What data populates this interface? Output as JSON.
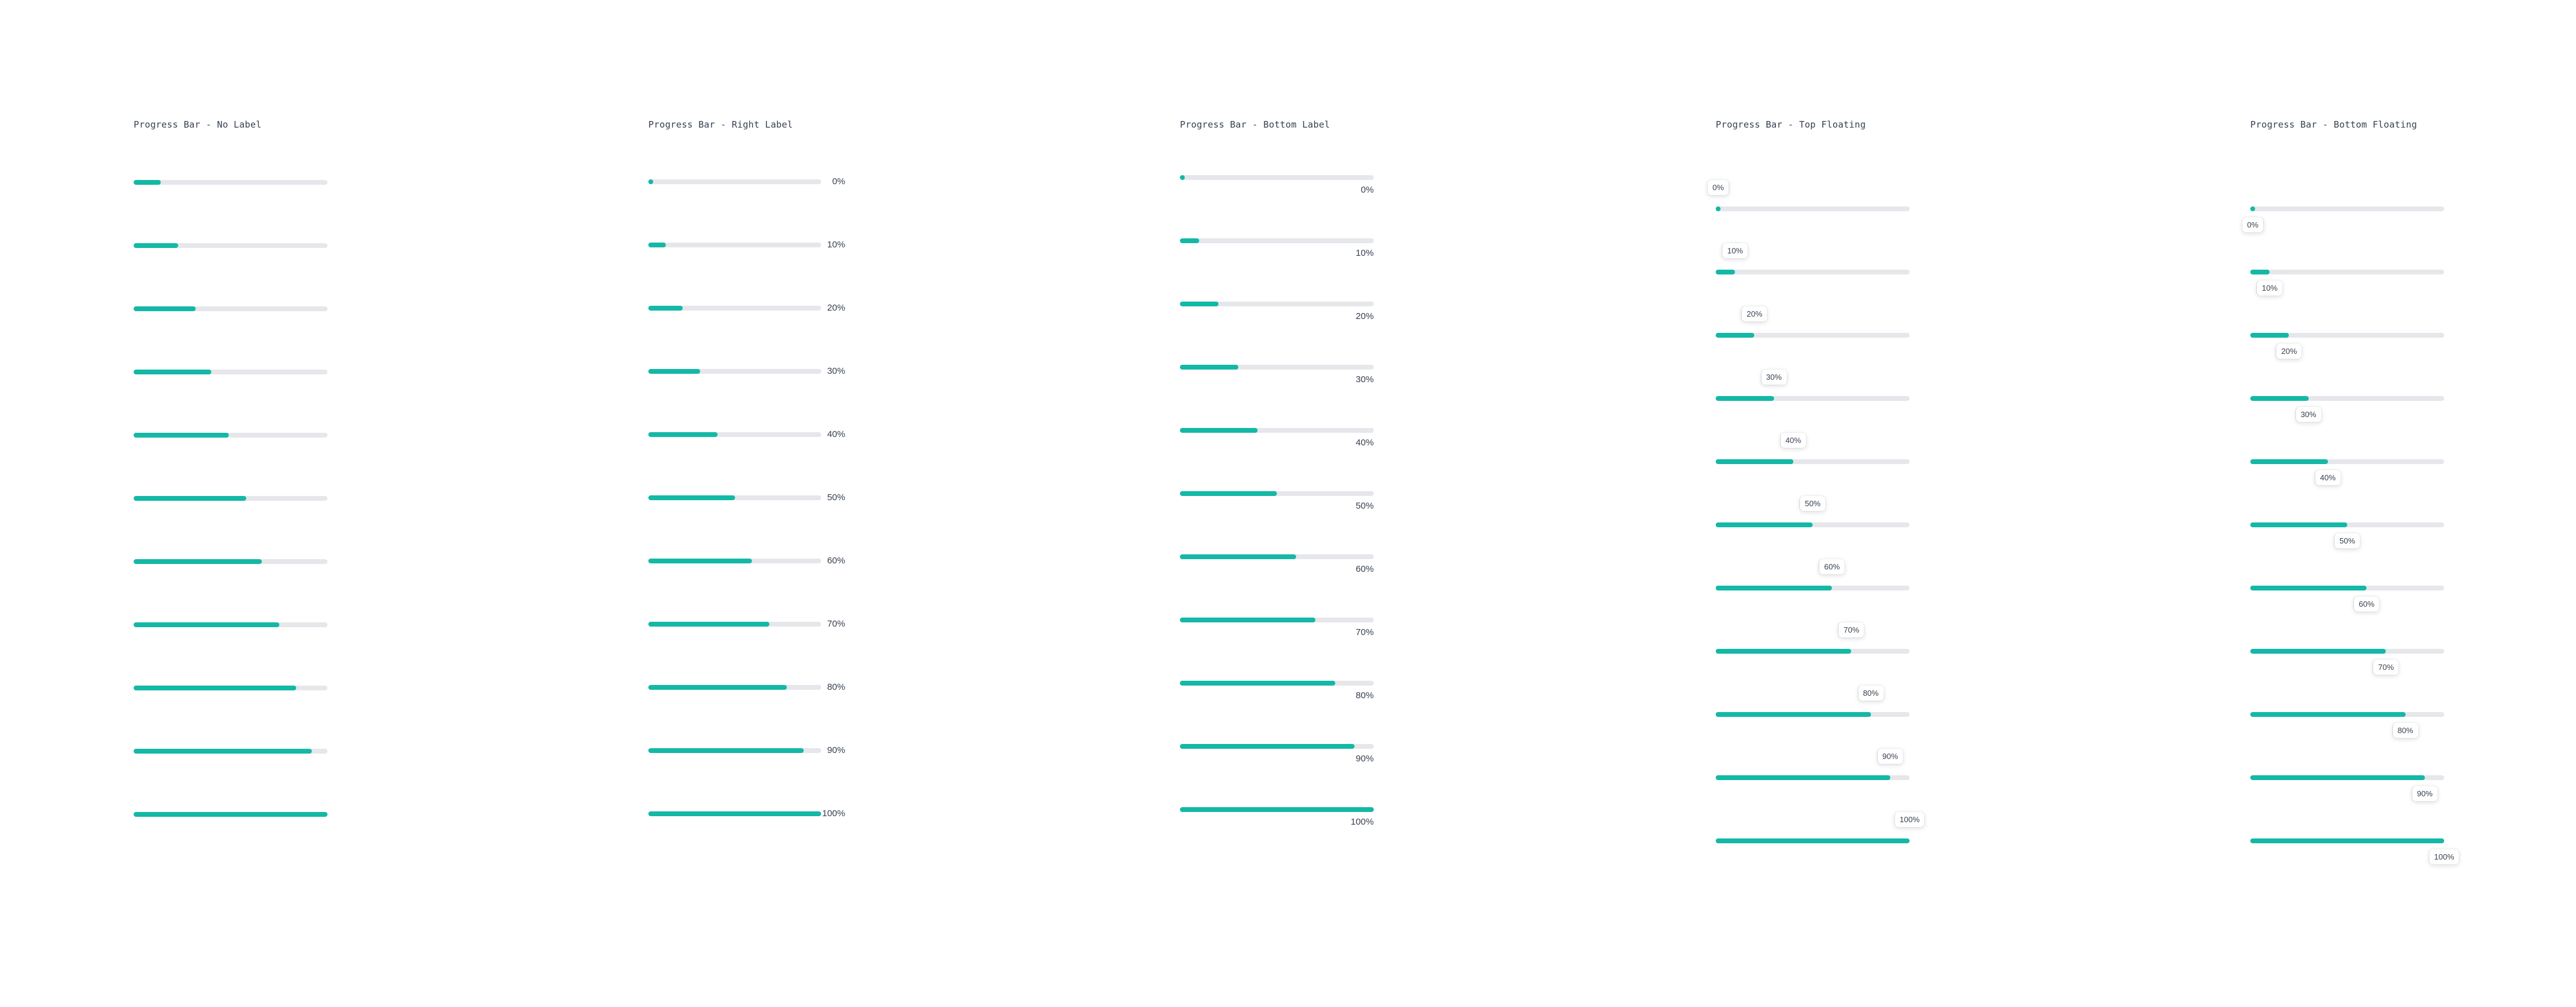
{
  "colors": {
    "fill": "#14b8a6",
    "track": "#e5e7eb",
    "text": "#374151"
  },
  "columns": [
    {
      "title": "Progress Bar - No Label",
      "label_style": "none",
      "items": [
        {
          "value": 0.14,
          "label": ""
        },
        {
          "value": 0.23,
          "label": ""
        },
        {
          "value": 0.32,
          "label": ""
        },
        {
          "value": 0.4,
          "label": ""
        },
        {
          "value": 0.49,
          "label": ""
        },
        {
          "value": 0.58,
          "label": ""
        },
        {
          "value": 0.66,
          "label": ""
        },
        {
          "value": 0.75,
          "label": ""
        },
        {
          "value": 0.84,
          "label": ""
        },
        {
          "value": 0.92,
          "label": ""
        },
        {
          "value": 1.0,
          "label": ""
        }
      ]
    },
    {
      "title": "Progress Bar - Right Label",
      "label_style": "right",
      "items": [
        {
          "value": 0.0,
          "label": "0%"
        },
        {
          "value": 0.1,
          "label": "10%"
        },
        {
          "value": 0.2,
          "label": "20%"
        },
        {
          "value": 0.3,
          "label": "30%"
        },
        {
          "value": 0.4,
          "label": "40%"
        },
        {
          "value": 0.5,
          "label": "50%"
        },
        {
          "value": 0.6,
          "label": "60%"
        },
        {
          "value": 0.7,
          "label": "70%"
        },
        {
          "value": 0.8,
          "label": "80%"
        },
        {
          "value": 0.9,
          "label": "90%"
        },
        {
          "value": 1.0,
          "label": "100%"
        }
      ]
    },
    {
      "title": "Progress Bar - Bottom Label",
      "label_style": "bottom",
      "items": [
        {
          "value": 0.0,
          "label": "0%"
        },
        {
          "value": 0.1,
          "label": "10%"
        },
        {
          "value": 0.2,
          "label": "20%"
        },
        {
          "value": 0.3,
          "label": "30%"
        },
        {
          "value": 0.4,
          "label": "40%"
        },
        {
          "value": 0.5,
          "label": "50%"
        },
        {
          "value": 0.6,
          "label": "60%"
        },
        {
          "value": 0.7,
          "label": "70%"
        },
        {
          "value": 0.8,
          "label": "80%"
        },
        {
          "value": 0.9,
          "label": "90%"
        },
        {
          "value": 1.0,
          "label": "100%"
        }
      ]
    },
    {
      "title": "Progress Bar - Top Floating",
      "label_style": "top-floating",
      "items": [
        {
          "value": 0.0,
          "label": "0%"
        },
        {
          "value": 0.1,
          "label": "10%"
        },
        {
          "value": 0.2,
          "label": "20%"
        },
        {
          "value": 0.3,
          "label": "30%"
        },
        {
          "value": 0.4,
          "label": "40%"
        },
        {
          "value": 0.5,
          "label": "50%"
        },
        {
          "value": 0.6,
          "label": "60%"
        },
        {
          "value": 0.7,
          "label": "70%"
        },
        {
          "value": 0.8,
          "label": "80%"
        },
        {
          "value": 0.9,
          "label": "90%"
        },
        {
          "value": 1.0,
          "label": "100%"
        }
      ]
    },
    {
      "title": "Progress Bar - Bottom Floating",
      "label_style": "bottom-floating",
      "items": [
        {
          "value": 0.0,
          "label": "0%"
        },
        {
          "value": 0.1,
          "label": "10%"
        },
        {
          "value": 0.2,
          "label": "20%"
        },
        {
          "value": 0.3,
          "label": "30%"
        },
        {
          "value": 0.4,
          "label": "40%"
        },
        {
          "value": 0.5,
          "label": "50%"
        },
        {
          "value": 0.6,
          "label": "60%"
        },
        {
          "value": 0.7,
          "label": "70%"
        },
        {
          "value": 0.8,
          "label": "80%"
        },
        {
          "value": 0.9,
          "label": "90%"
        },
        {
          "value": 1.0,
          "label": "100%"
        }
      ]
    }
  ]
}
